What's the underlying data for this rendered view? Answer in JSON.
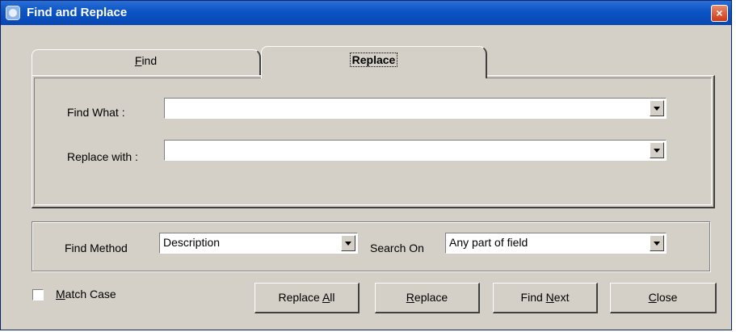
{
  "window": {
    "title": "Find and Replace",
    "close_glyph": "×"
  },
  "tabs": [
    {
      "label": "Find",
      "mnemonic": "F",
      "rest": "ind",
      "selected": false
    },
    {
      "label": "Replace",
      "selected": true
    }
  ],
  "replace_panel": {
    "find_what_label": "Find What :",
    "find_what_value": "",
    "replace_with_label": "Replace with :",
    "replace_with_value": ""
  },
  "options": {
    "find_method_label": "Find Method",
    "find_method_value": "Description",
    "search_on_label": "Search On",
    "search_on_value": "Any part of field"
  },
  "match_case": {
    "label": "Match Case",
    "mnemonic": "M",
    "rest": "atch Case",
    "checked": false
  },
  "buttons": {
    "replace_all": {
      "label": "Replace All",
      "pre": "Replace ",
      "mnemonic": "A",
      "post": "ll"
    },
    "replace": {
      "label": "Replace",
      "pre": "",
      "mnemonic": "R",
      "post": "eplace"
    },
    "find_next": {
      "label": "Find Next",
      "pre": "Find ",
      "mnemonic": "N",
      "post": "ext"
    },
    "close": {
      "label": "Close",
      "pre": "",
      "mnemonic": "C",
      "post": "lose"
    }
  },
  "icons": {
    "app": "app-icon",
    "close": "close-icon",
    "dropdown": "dropdown-arrow-icon"
  },
  "colors": {
    "titlebar": "#0b53c4",
    "face": "#d4d0c8",
    "close_button": "#cc3a16"
  }
}
